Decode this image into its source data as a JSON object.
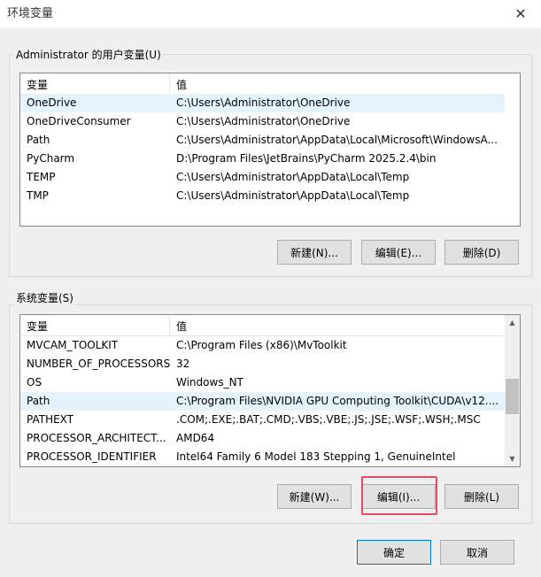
{
  "window": {
    "title": "环境变量",
    "close_glyph": "✕"
  },
  "user_vars": {
    "group_label": "Administrator 的用户变量(U)",
    "col_name": "变量",
    "col_value": "值",
    "rows": [
      {
        "name": "OneDrive",
        "value": "C:\\Users\\Administrator\\OneDrive",
        "selected": true
      },
      {
        "name": "OneDriveConsumer",
        "value": "C:\\Users\\Administrator\\OneDrive",
        "selected": false
      },
      {
        "name": "Path",
        "value": "C:\\Users\\Administrator\\AppData\\Local\\Microsoft\\WindowsA...",
        "selected": false
      },
      {
        "name": "PyCharm",
        "value": "D:\\Program Files\\JetBrains\\PyCharm 2025.2.4\\bin",
        "selected": false
      },
      {
        "name": "TEMP",
        "value": "C:\\Users\\Administrator\\AppData\\Local\\Temp",
        "selected": false
      },
      {
        "name": "TMP",
        "value": "C:\\Users\\Administrator\\AppData\\Local\\Temp",
        "selected": false
      }
    ],
    "buttons": {
      "new": "新建(N)...",
      "edit": "编辑(E)...",
      "delete": "删除(D)"
    }
  },
  "system_vars": {
    "group_label": "系统变量(S)",
    "col_name": "变量",
    "col_value": "值",
    "rows": [
      {
        "name": "MVCAM_TOOLKIT",
        "value": "C:\\Program Files (x86)\\MvToolkit",
        "selected": false
      },
      {
        "name": "NUMBER_OF_PROCESSORS",
        "value": "32",
        "selected": false
      },
      {
        "name": "OS",
        "value": "Windows_NT",
        "selected": false
      },
      {
        "name": "Path",
        "value": "C:\\Program Files\\NVIDIA GPU Computing Toolkit\\CUDA\\v12....",
        "selected": true
      },
      {
        "name": "PATHEXT",
        "value": ".COM;.EXE;.BAT;.CMD;.VBS;.VBE;.JS;.JSE;.WSF;.WSH;.MSC",
        "selected": false
      },
      {
        "name": "PROCESSOR_ARCHITECT...",
        "value": "AMD64",
        "selected": false
      },
      {
        "name": "PROCESSOR_IDENTIFIER",
        "value": "Intel64 Family 6 Model 183 Stepping 1, GenuineIntel",
        "selected": false
      }
    ],
    "buttons": {
      "new": "新建(W)...",
      "edit": "编辑(I)...",
      "delete": "删除(L)"
    }
  },
  "footer": {
    "ok": "确定",
    "cancel": "取消"
  },
  "colors": {
    "highlight": "#e84a5f",
    "selection": "#e5f3ff",
    "default_border": "#0078d7"
  }
}
